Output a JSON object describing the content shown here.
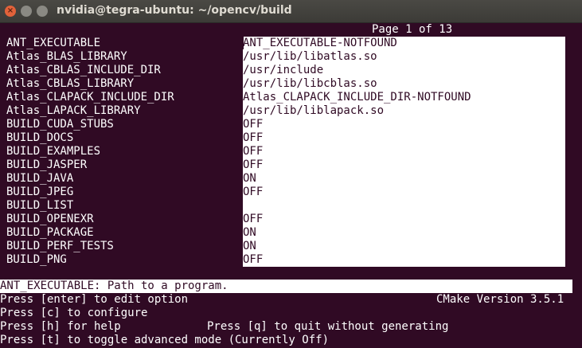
{
  "window": {
    "title": "nvidia@tegra-ubuntu: ~/opencv/build",
    "close_glyph": "×",
    "min_glyph": "",
    "max_glyph": ""
  },
  "page_indicator": "Page 1 of 13",
  "entries": [
    {
      "key": "ANT_EXECUTABLE",
      "value": "ANT_EXECUTABLE-NOTFOUND"
    },
    {
      "key": "Atlas_BLAS_LIBRARY",
      "value": "/usr/lib/libatlas.so"
    },
    {
      "key": "Atlas_CBLAS_INCLUDE_DIR",
      "value": "/usr/include"
    },
    {
      "key": "Atlas_CBLAS_LIBRARY",
      "value": "/usr/lib/libcblas.so"
    },
    {
      "key": "Atlas_CLAPACK_INCLUDE_DIR",
      "value": "Atlas_CLAPACK_INCLUDE_DIR-NOTFOUND"
    },
    {
      "key": "Atlas_LAPACK_LIBRARY",
      "value": "/usr/lib/liblapack.so"
    },
    {
      "key": "BUILD_CUDA_STUBS",
      "value": "OFF"
    },
    {
      "key": "BUILD_DOCS",
      "value": "OFF"
    },
    {
      "key": "BUILD_EXAMPLES",
      "value": "OFF"
    },
    {
      "key": "BUILD_JASPER",
      "value": "OFF"
    },
    {
      "key": "BUILD_JAVA",
      "value": "ON"
    },
    {
      "key": "BUILD_JPEG",
      "value": "OFF"
    },
    {
      "key": "BUILD_LIST",
      "value": ""
    },
    {
      "key": "BUILD_OPENEXR",
      "value": "OFF"
    },
    {
      "key": "BUILD_PACKAGE",
      "value": "ON"
    },
    {
      "key": "BUILD_PERF_TESTS",
      "value": "ON"
    },
    {
      "key": "BUILD_PNG",
      "value": "OFF"
    }
  ],
  "help_line": "ANT_EXECUTABLE: Path to a program.",
  "footer": {
    "line1": "Press [enter] to edit option",
    "cmake_version": "CMake Version 3.5.1",
    "line2": "Press [c] to configure",
    "line3": "Press [h] for help",
    "quit_hint": "Press [q] to quit without generating",
    "line4": "Press [t] to toggle advanced mode (Currently Off)"
  },
  "colors": {
    "terminal_bg": "#300a24",
    "terminal_fg": "#ffffff",
    "titlebar_bg": "#3c3b37",
    "close_button": "#e2623a"
  }
}
